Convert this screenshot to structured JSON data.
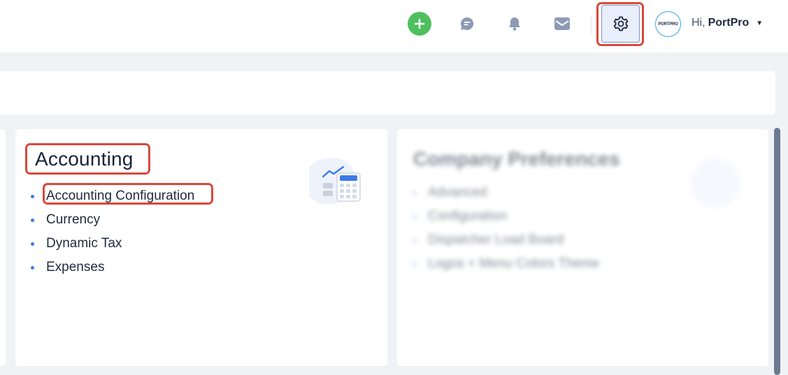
{
  "header": {
    "greeting_prefix": "Hi,",
    "user_name": "PortPro",
    "avatar_text": "PORTPRO",
    "icons": {
      "add": "plus-icon",
      "chat": "chat-icon",
      "notifications": "bell-icon",
      "mail": "mail-icon",
      "settings": "gear-icon",
      "dropdown": "caret-down-icon"
    },
    "colors": {
      "add_button": "#4fbf5e",
      "highlight": "#d9483b",
      "settings_bg": "#e8eefc"
    }
  },
  "cards": {
    "accounting": {
      "title": "Accounting",
      "items": [
        "Accounting Configuration",
        "Currency",
        "Dynamic Tax",
        "Expenses"
      ],
      "icon": "calculator-chart-icon"
    },
    "company": {
      "title": "Company Preferences",
      "items": [
        "Advanced",
        "Configuration",
        "Dispatcher Load Board",
        "Logos + Menu Colors Theme"
      ],
      "blurred": true
    }
  },
  "bullet_color": "#3b7be8"
}
